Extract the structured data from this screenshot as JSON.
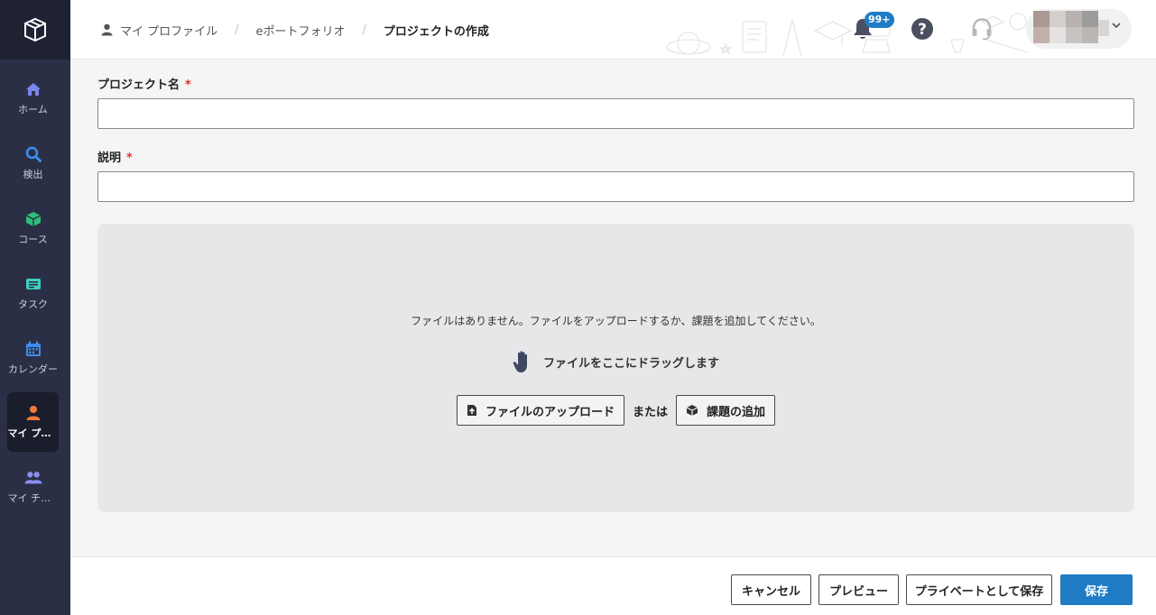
{
  "sidebar": {
    "items": [
      {
        "label": "ホーム",
        "icon": "home-icon",
        "color": "#7a86f0"
      },
      {
        "label": "検出",
        "icon": "search-icon",
        "color": "#3b8ef0"
      },
      {
        "label": "コース",
        "icon": "cube-icon",
        "color": "#2fbf7a"
      },
      {
        "label": "タスク",
        "icon": "task-icon",
        "color": "#3fcfc0"
      },
      {
        "label": "カレンダー",
        "icon": "calendar-icon",
        "color": "#3b8ef0"
      },
      {
        "label": "マイ プロ…",
        "icon": "user-icon",
        "color": "#f07a3b",
        "active": true
      },
      {
        "label": "マイ チーム",
        "icon": "team-icon",
        "color": "#8a8ff0"
      }
    ]
  },
  "breadcrumb": {
    "items": [
      "マイ プロファイル",
      "eポートフォリオ",
      "プロジェクトの作成"
    ],
    "separator": "/"
  },
  "header": {
    "notification_count": "99+",
    "accent_color": "#1f7cc4"
  },
  "form": {
    "project_name_label": "プロジェクト名",
    "description_label": "説明",
    "required_mark": "*",
    "project_name_value": "",
    "description_value": ""
  },
  "dropzone": {
    "message": "ファイルはありません。ファイルをアップロードするか、課題を追加してください。",
    "drag_text": "ファイルをここにドラッグします",
    "upload_label": "ファイルのアップロード",
    "or_text": "または",
    "add_assignment_label": "課題の追加"
  },
  "footer": {
    "cancel_label": "キャンセル",
    "preview_label": "プレビュー",
    "save_private_label": "プライベートとして保存",
    "save_label": "保存"
  }
}
